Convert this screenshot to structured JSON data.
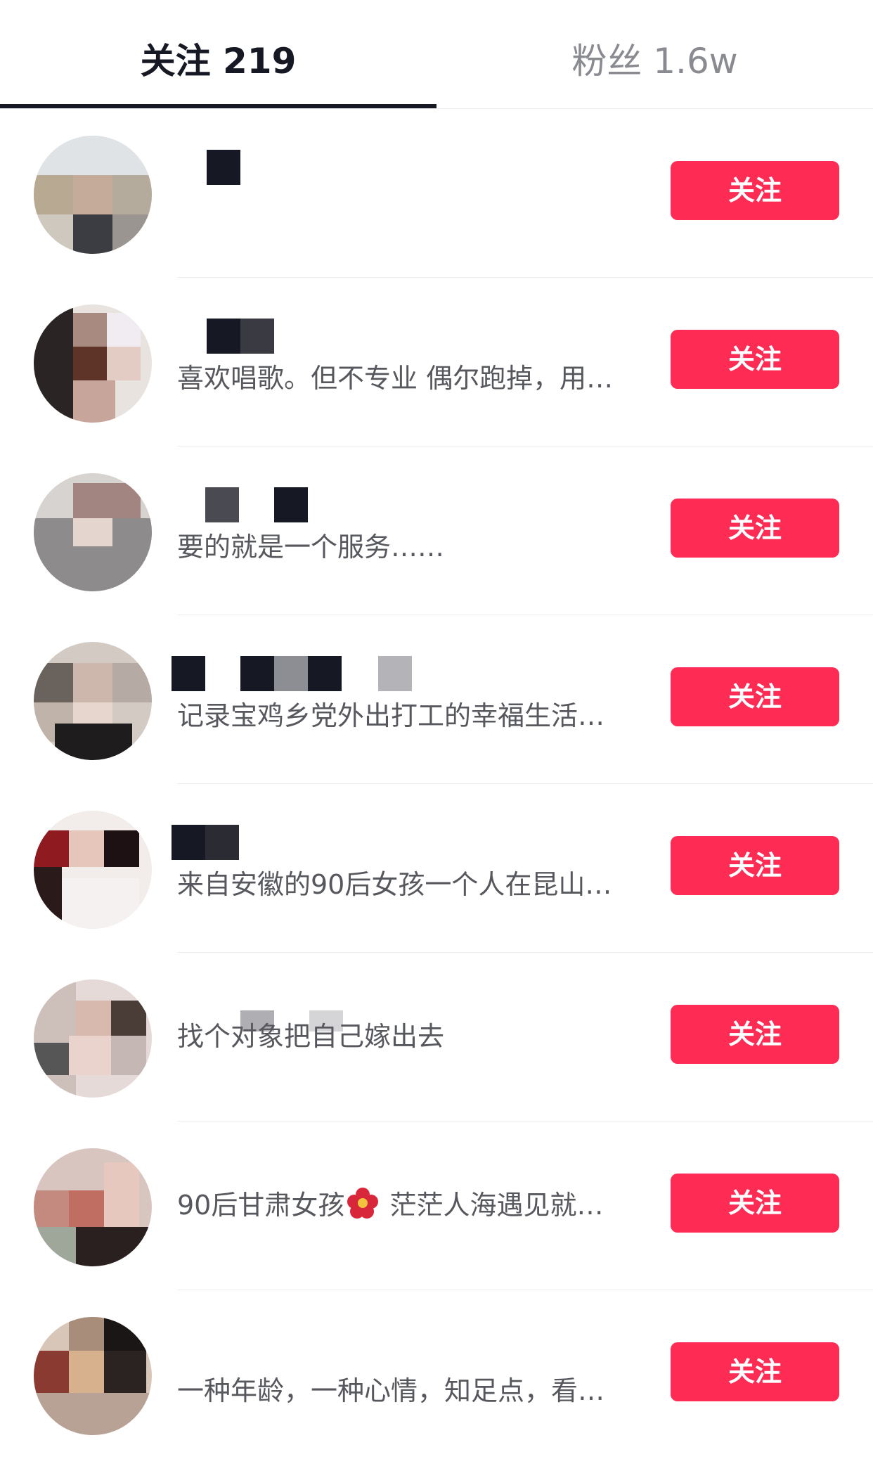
{
  "tabs": {
    "following_label": "关注 219",
    "followers_label": "粉丝 1.6w"
  },
  "colors": {
    "accent": "#fe2c55",
    "text_primary": "#161823",
    "text_secondary": "#57585e"
  },
  "rows": [
    {
      "bio": "",
      "button": "关注"
    },
    {
      "bio": "喜欢唱歌。但不专业 偶尔跑掉，用…",
      "button": "关注"
    },
    {
      "bio": "要的就是一个服务……",
      "button": "关注"
    },
    {
      "bio": "记录宝鸡乡党外出打工的幸福生活…",
      "button": "关注"
    },
    {
      "bio": "来自安徽的90后女孩一个人在昆山…",
      "button": "关注"
    },
    {
      "bio": "找个对象把自己嫁出去",
      "button": "关注"
    },
    {
      "bio_before": "90后甘肃女孩",
      "bio_icon": "hibiscus-emoji",
      "bio_after": " 茫茫人海遇见就…",
      "button": "关注"
    },
    {
      "bio": "一种年龄，一种心情，知足点，看…",
      "button": "关注"
    }
  ]
}
